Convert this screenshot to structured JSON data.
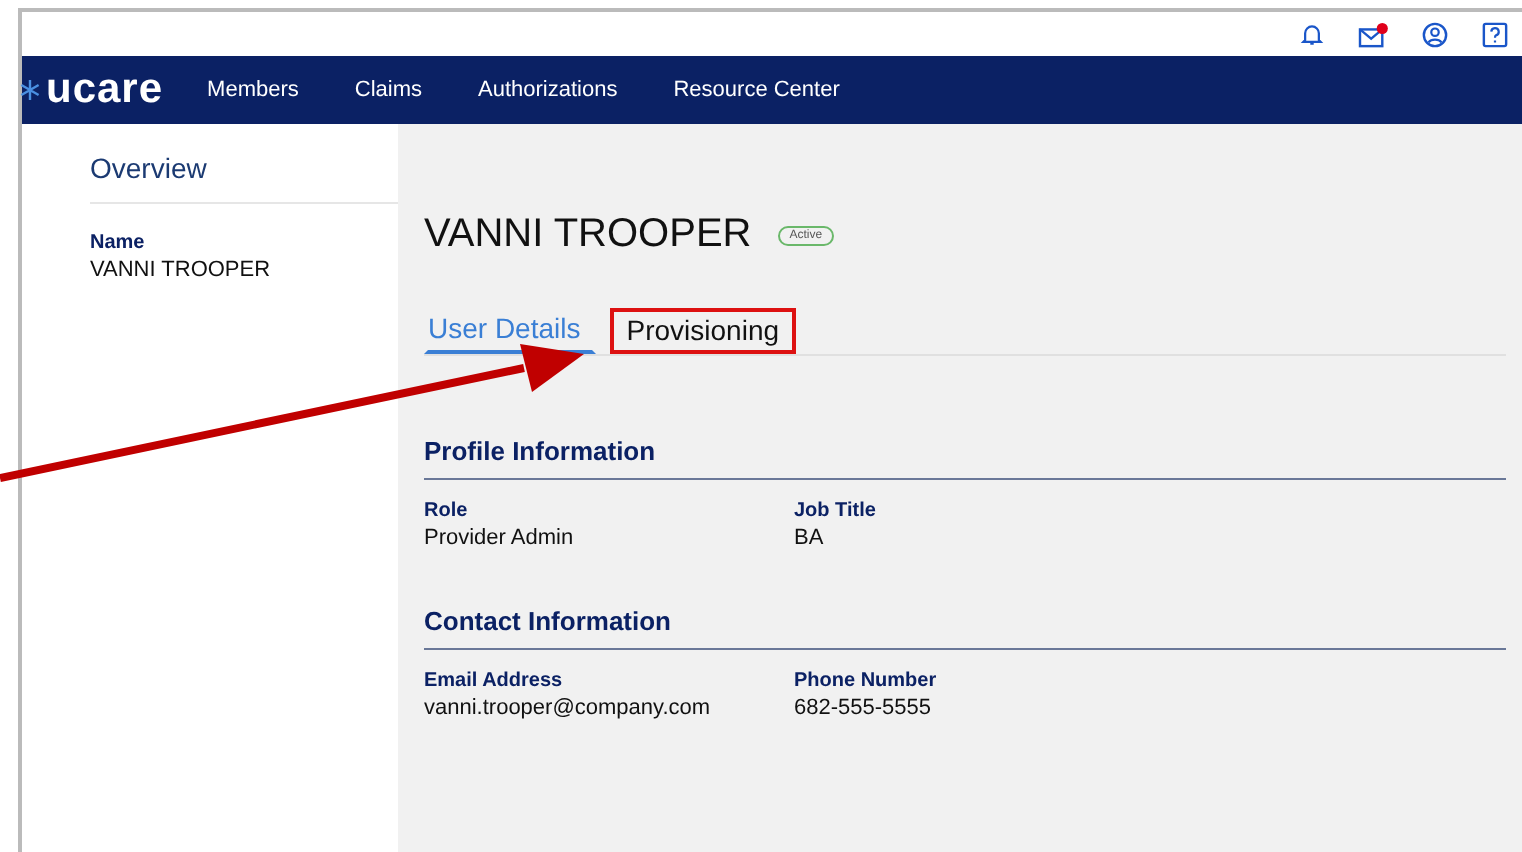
{
  "top_bar": {
    "notification_badge": true
  },
  "nav": {
    "logo": "ucare",
    "items": [
      "Members",
      "Claims",
      "Authorizations",
      "Resource Center"
    ]
  },
  "sidebar": {
    "title": "Overview",
    "fields": [
      {
        "label": "Name",
        "value": "VANNI TROOPER"
      }
    ]
  },
  "profile": {
    "name": "VANNI TROOPER",
    "status": "Active"
  },
  "tabs": [
    {
      "label": "User Details",
      "selected": true,
      "highlighted": false
    },
    {
      "label": "Provisioning",
      "selected": false,
      "highlighted": true
    }
  ],
  "sections": [
    {
      "title": "Profile Information",
      "fields": [
        {
          "label": "Role",
          "value": "Provider Admin"
        },
        {
          "label": "Job Title",
          "value": "BA"
        }
      ]
    },
    {
      "title": "Contact Information",
      "fields": [
        {
          "label": "Email Address",
          "value": "vanni.trooper@company.com"
        },
        {
          "label": "Phone Number",
          "value": "682-555-5555"
        }
      ]
    }
  ]
}
